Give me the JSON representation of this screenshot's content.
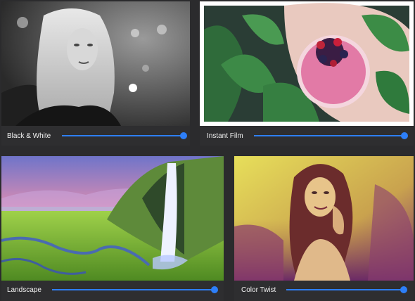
{
  "filters": [
    {
      "id": "black-white",
      "label": "Black & White",
      "value": 1.0
    },
    {
      "id": "instant-film",
      "label": "Instant Film",
      "value": 1.0
    },
    {
      "id": "landscape",
      "label": "Landscape",
      "value": 1.0
    },
    {
      "id": "color-twist",
      "label": "Color Twist",
      "value": 1.0
    }
  ],
  "colors": {
    "background": "#2b2b2d",
    "accent": "#2d7ff9",
    "track": "#d9d9d9",
    "label": "#f2f2f2"
  }
}
